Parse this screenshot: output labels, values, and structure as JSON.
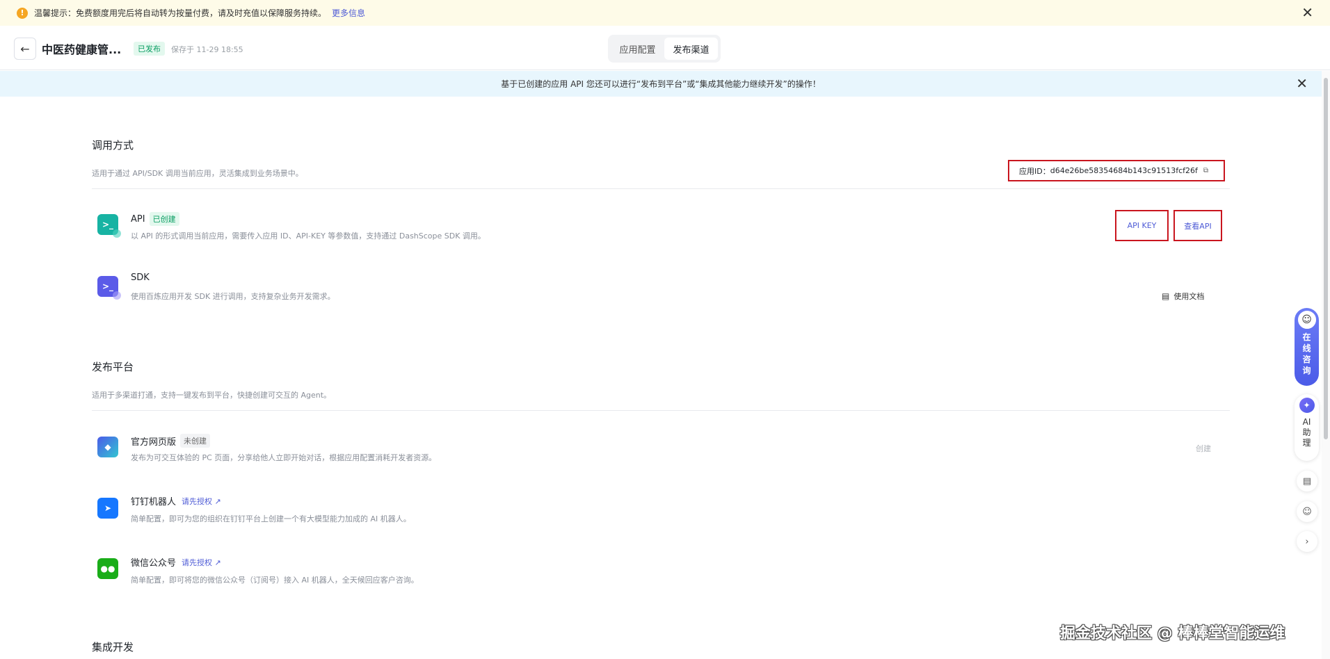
{
  "notice": {
    "text": "温馨提示：免费额度用完后将自动转为按量付费，请及时充值以保障服务持续。",
    "link": "更多信息"
  },
  "header": {
    "app_name": "中医药健康管...",
    "status": "已发布",
    "saved": "保存于 11-29 18:55",
    "tabs": [
      {
        "label": "应用配置",
        "active": false
      },
      {
        "label": "发布渠道",
        "active": true
      }
    ]
  },
  "infobar": {
    "text": "基于已创建的应用 API 您还可以进行“发布到平台”或“集成其他能力继续开发”的操作！"
  },
  "invoke": {
    "title": "调用方式",
    "desc": "适用于通过 API/SDK 调用当前应用，灵活集成到业务场景中。",
    "app_id_label": "应用ID：",
    "app_id_value": "d64e26be58354684b143c91513fcf26f",
    "api": {
      "title": "API",
      "tag": "已创建",
      "desc": "以 API 的形式调用当前应用，需要传入应用 ID、API-KEY 等参数值，支持通过 DashScope SDK 调用。",
      "btn_key": "API KEY",
      "btn_view": "查看API"
    },
    "sdk": {
      "title": "SDK",
      "desc": "使用百炼应用开发 SDK 进行调用，支持复杂业务开发需求。",
      "doc": "使用文档"
    }
  },
  "publish": {
    "title": "发布平台",
    "desc": "适用于多渠道打通，支持一键发布到平台，快捷创建可交互的 Agent。",
    "items": [
      {
        "title": "官方网页版",
        "tag": "未创建",
        "desc": "发布为可交互体验的 PC 页面，分享给他人立即开始对话，根据应用配置消耗开发者资源。",
        "action": "创建"
      },
      {
        "title": "钉钉机器人",
        "tag": "请先授权 ↗",
        "desc": "简单配置，即可为您的组织在钉钉平台上创建一个有大模型能力加成的 AI 机器人。"
      },
      {
        "title": "微信公众号",
        "tag": "请先授权 ↗",
        "desc": "简单配置，即可将您的微信公众号（订阅号）接入 AI 机器人，全天候回应客户咨询。"
      }
    ]
  },
  "integrate": {
    "title": "集成开发"
  },
  "float": {
    "consult": "在线咨询",
    "ai": "AI助理"
  },
  "watermark": "掘金技术社区 @ 棒棒堂智能运维",
  "colors": {
    "accent": "#4e5bd6",
    "highlight_border": "#c9151e",
    "success": "#0b9e63"
  }
}
